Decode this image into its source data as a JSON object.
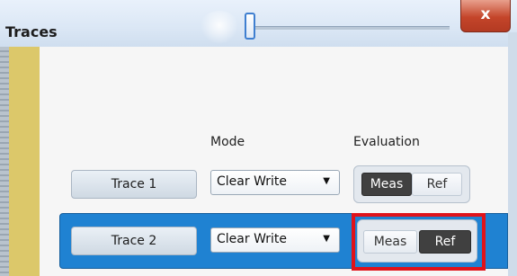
{
  "window": {
    "title": "Traces",
    "close_label": "x"
  },
  "headers": {
    "mode": "Mode",
    "evaluation": "Evaluation"
  },
  "traces": [
    {
      "label": "Trace 1",
      "mode": "Clear Write",
      "eval_meas": "Meas",
      "eval_ref": "Ref",
      "selected_eval": "Meas",
      "row_selected": false
    },
    {
      "label": "Trace 2",
      "mode": "Clear Write",
      "eval_meas": "Meas",
      "eval_ref": "Ref",
      "selected_eval": "Ref",
      "row_selected": true
    }
  ],
  "icons": {
    "dropdown": "chevron-down-icon",
    "close": "close-icon"
  },
  "colors": {
    "row_highlight": "#1f82d2",
    "red_highlight": "#e0131a",
    "segment_selected": "#404040",
    "side_strip": "#dcc86a"
  }
}
